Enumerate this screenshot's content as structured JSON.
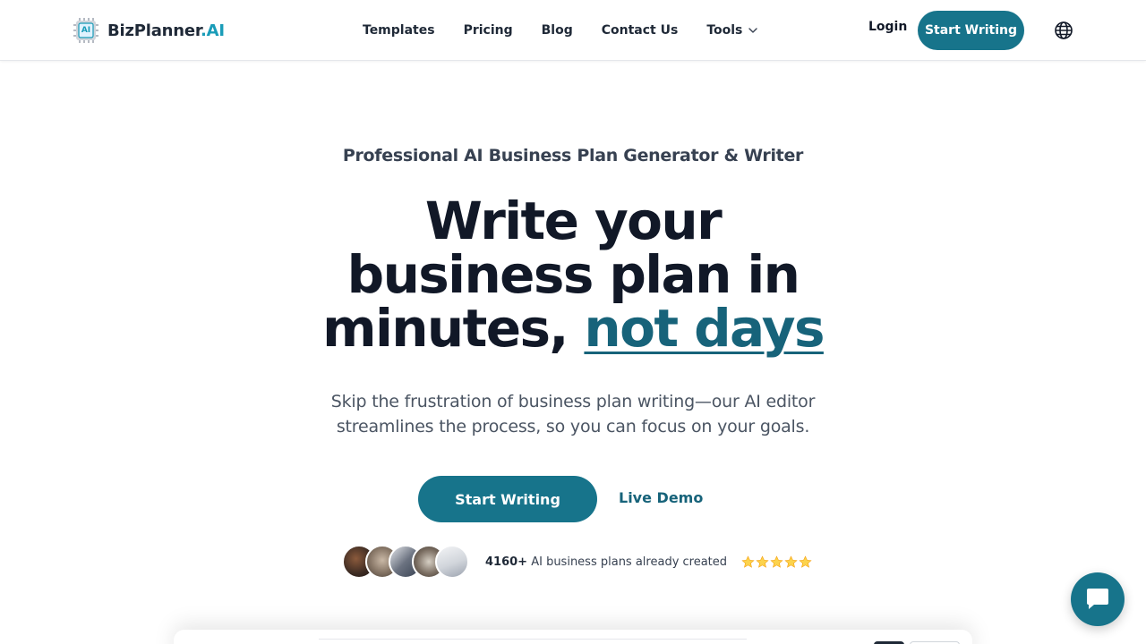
{
  "brand": {
    "name": "BizPlanner",
    "suffix": ".AI",
    "logo_badge": "AI",
    "accent_color": "#1a9cb8",
    "primary_color": "#17748b"
  },
  "nav": {
    "items": [
      {
        "label": "Templates"
      },
      {
        "label": "Pricing"
      },
      {
        "label": "Blog"
      },
      {
        "label": "Contact Us"
      },
      {
        "label": "Tools",
        "icon": "chevron-down-icon"
      }
    ],
    "login_label": "Login",
    "cta_label": "Start Writing",
    "language_icon": "globe-icon"
  },
  "hero": {
    "eyebrow": "Professional AI Business Plan Generator & Writer",
    "headline_part1": "Write your business plan in minutes, ",
    "headline_accent": "not days",
    "subtext": "Skip the frustration of business plan writing—our AI editor streamlines the process, so you can focus on your goals.",
    "primary_cta": "Start Writing",
    "secondary_cta": "Live Demo"
  },
  "social_proof": {
    "count": "4160+",
    "text": " AI business plans already created",
    "rating_stars": 5,
    "avatar_count": 5
  },
  "chat": {
    "icon": "chat-bubble-icon"
  }
}
